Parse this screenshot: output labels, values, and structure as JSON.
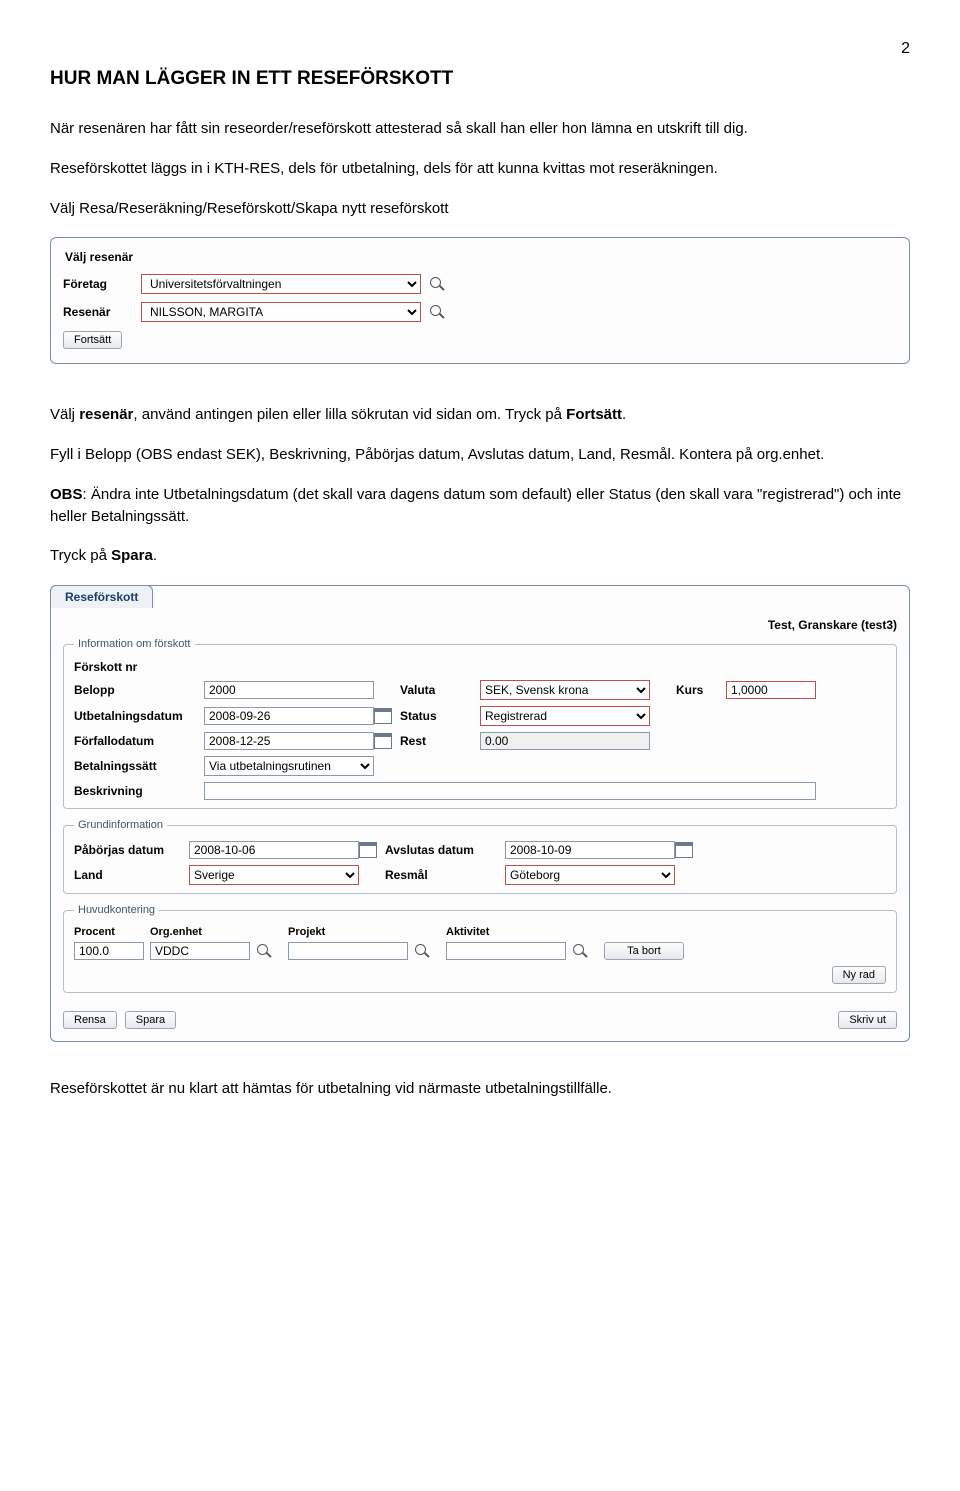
{
  "page_number": "2",
  "title": "HUR MAN LÄGGER IN ETT RESEFÖRSKOTT",
  "para1": "När resenären har fått sin reseorder/reseförskott attesterad så skall han eller hon lämna en utskrift till dig.",
  "para2": "Reseförskottet läggs in i KTH-RES, dels för utbetalning, dels för att kunna kvittas mot reseräkningen.",
  "para3": "Välj Resa/Reseräkning/Reseförskott/Skapa nytt reseförskott",
  "panel1": {
    "title": "Välj resenär",
    "row_company_label": "Företag",
    "row_company_value": "Universitetsförvaltningen",
    "row_traveller_label": "Resenär",
    "row_traveller_value": "NILSSON, MARGITA",
    "btn_continue": "Fortsätt"
  },
  "para4_pre": "Välj ",
  "para4_bold1": "resenär",
  "para4_mid": ", använd antingen pilen eller lilla sökrutan vid sidan om. Tryck på ",
  "para4_bold2": "Fortsätt",
  "para4_post": ".",
  "para5": "Fyll i Belopp (OBS endast SEK), Beskrivning, Påbörjas datum, Avslutas datum, Land, Resmål. Kontera på org.enhet.",
  "para6_pre": "",
  "para6_bold": "OBS",
  "para6_rest": ": Ändra inte Utbetalningsdatum (det skall vara dagens datum som default) eller Status (den skall vara \"registrerad\") och inte heller Betalningssätt.",
  "para7_pre": "Tryck på ",
  "para7_bold": "Spara",
  "para7_post": ".",
  "panel2": {
    "tab": "Reseförskott",
    "user": "Test, Granskare (test3)",
    "fs1_legend": "Information om förskott",
    "lbl_forskott_nr": "Förskott nr",
    "lbl_belopp": "Belopp",
    "val_belopp": "2000",
    "lbl_valuta": "Valuta",
    "val_valuta": "SEK, Svensk krona",
    "lbl_kurs": "Kurs",
    "val_kurs": "1,0000",
    "lbl_utbet": "Utbetalningsdatum",
    "val_utbet": "2008-09-26",
    "lbl_status": "Status",
    "val_status": "Registrerad",
    "lbl_forfallo": "Förfallodatum",
    "val_forfallo": "2008-12-25",
    "lbl_rest": "Rest",
    "val_rest": "0.00",
    "lbl_betsatt": "Betalningssätt",
    "val_betsatt": "Via utbetalningsrutinen",
    "lbl_beskr": "Beskrivning",
    "val_beskr": "",
    "fs2_legend": "Grundinformation",
    "lbl_paborjas": "Påbörjas datum",
    "val_paborjas": "2008-10-06",
    "lbl_avslutas": "Avslutas datum",
    "val_avslutas": "2008-10-09",
    "lbl_land": "Land",
    "val_land": "Sverige",
    "lbl_resmal": "Resmål",
    "val_resmal": "Göteborg",
    "fs3_legend": "Huvudkontering",
    "hdr_procent": "Procent",
    "hdr_org": "Org.enhet",
    "hdr_projekt": "Projekt",
    "hdr_aktivitet": "Aktivitet",
    "val_procent": "100.0",
    "val_org": "VDDC",
    "val_projekt": "",
    "val_aktivitet": "",
    "btn_tabort": "Ta bort",
    "btn_nyrad": "Ny rad",
    "btn_rensa": "Rensa",
    "btn_spara": "Spara",
    "btn_skrivut": "Skriv ut"
  },
  "para8": "Reseförskottet är nu klart att hämtas för utbetalning vid närmaste utbetalningstillfälle."
}
